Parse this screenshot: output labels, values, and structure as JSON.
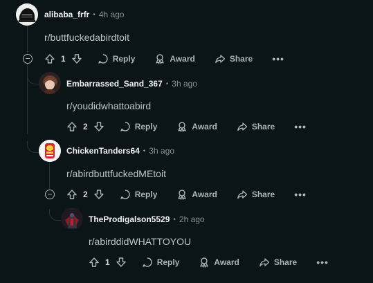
{
  "comments": [
    {
      "username": "alibaba_frfr",
      "time": "4h ago",
      "body": "r/buttfuckedabirdtoit",
      "votes": "1",
      "reply_label": "Reply",
      "award_label": "Award",
      "share_label": "Share"
    },
    {
      "username": "Embarrassed_Sand_367",
      "time": "3h ago",
      "body": "r/youdidwhattoabird",
      "votes": "2",
      "reply_label": "Reply",
      "award_label": "Award",
      "share_label": "Share"
    },
    {
      "username": "ChickenTanders64",
      "time": "3h ago",
      "body": "r/abirdbuttfuckedMEtoit",
      "votes": "2",
      "reply_label": "Reply",
      "award_label": "Award",
      "share_label": "Share"
    },
    {
      "username": "TheProdigalson5529",
      "time": "2h ago",
      "body": "r/abirddidWHATTOYOU",
      "votes": "1",
      "reply_label": "Reply",
      "award_label": "Award",
      "share_label": "Share"
    }
  ],
  "separator": "•",
  "colors": {
    "background": "#0b1416",
    "username": "#f2f4f5",
    "meta": "#82959b",
    "body": "#b7c5cc",
    "thread_line": "#2a3236"
  }
}
